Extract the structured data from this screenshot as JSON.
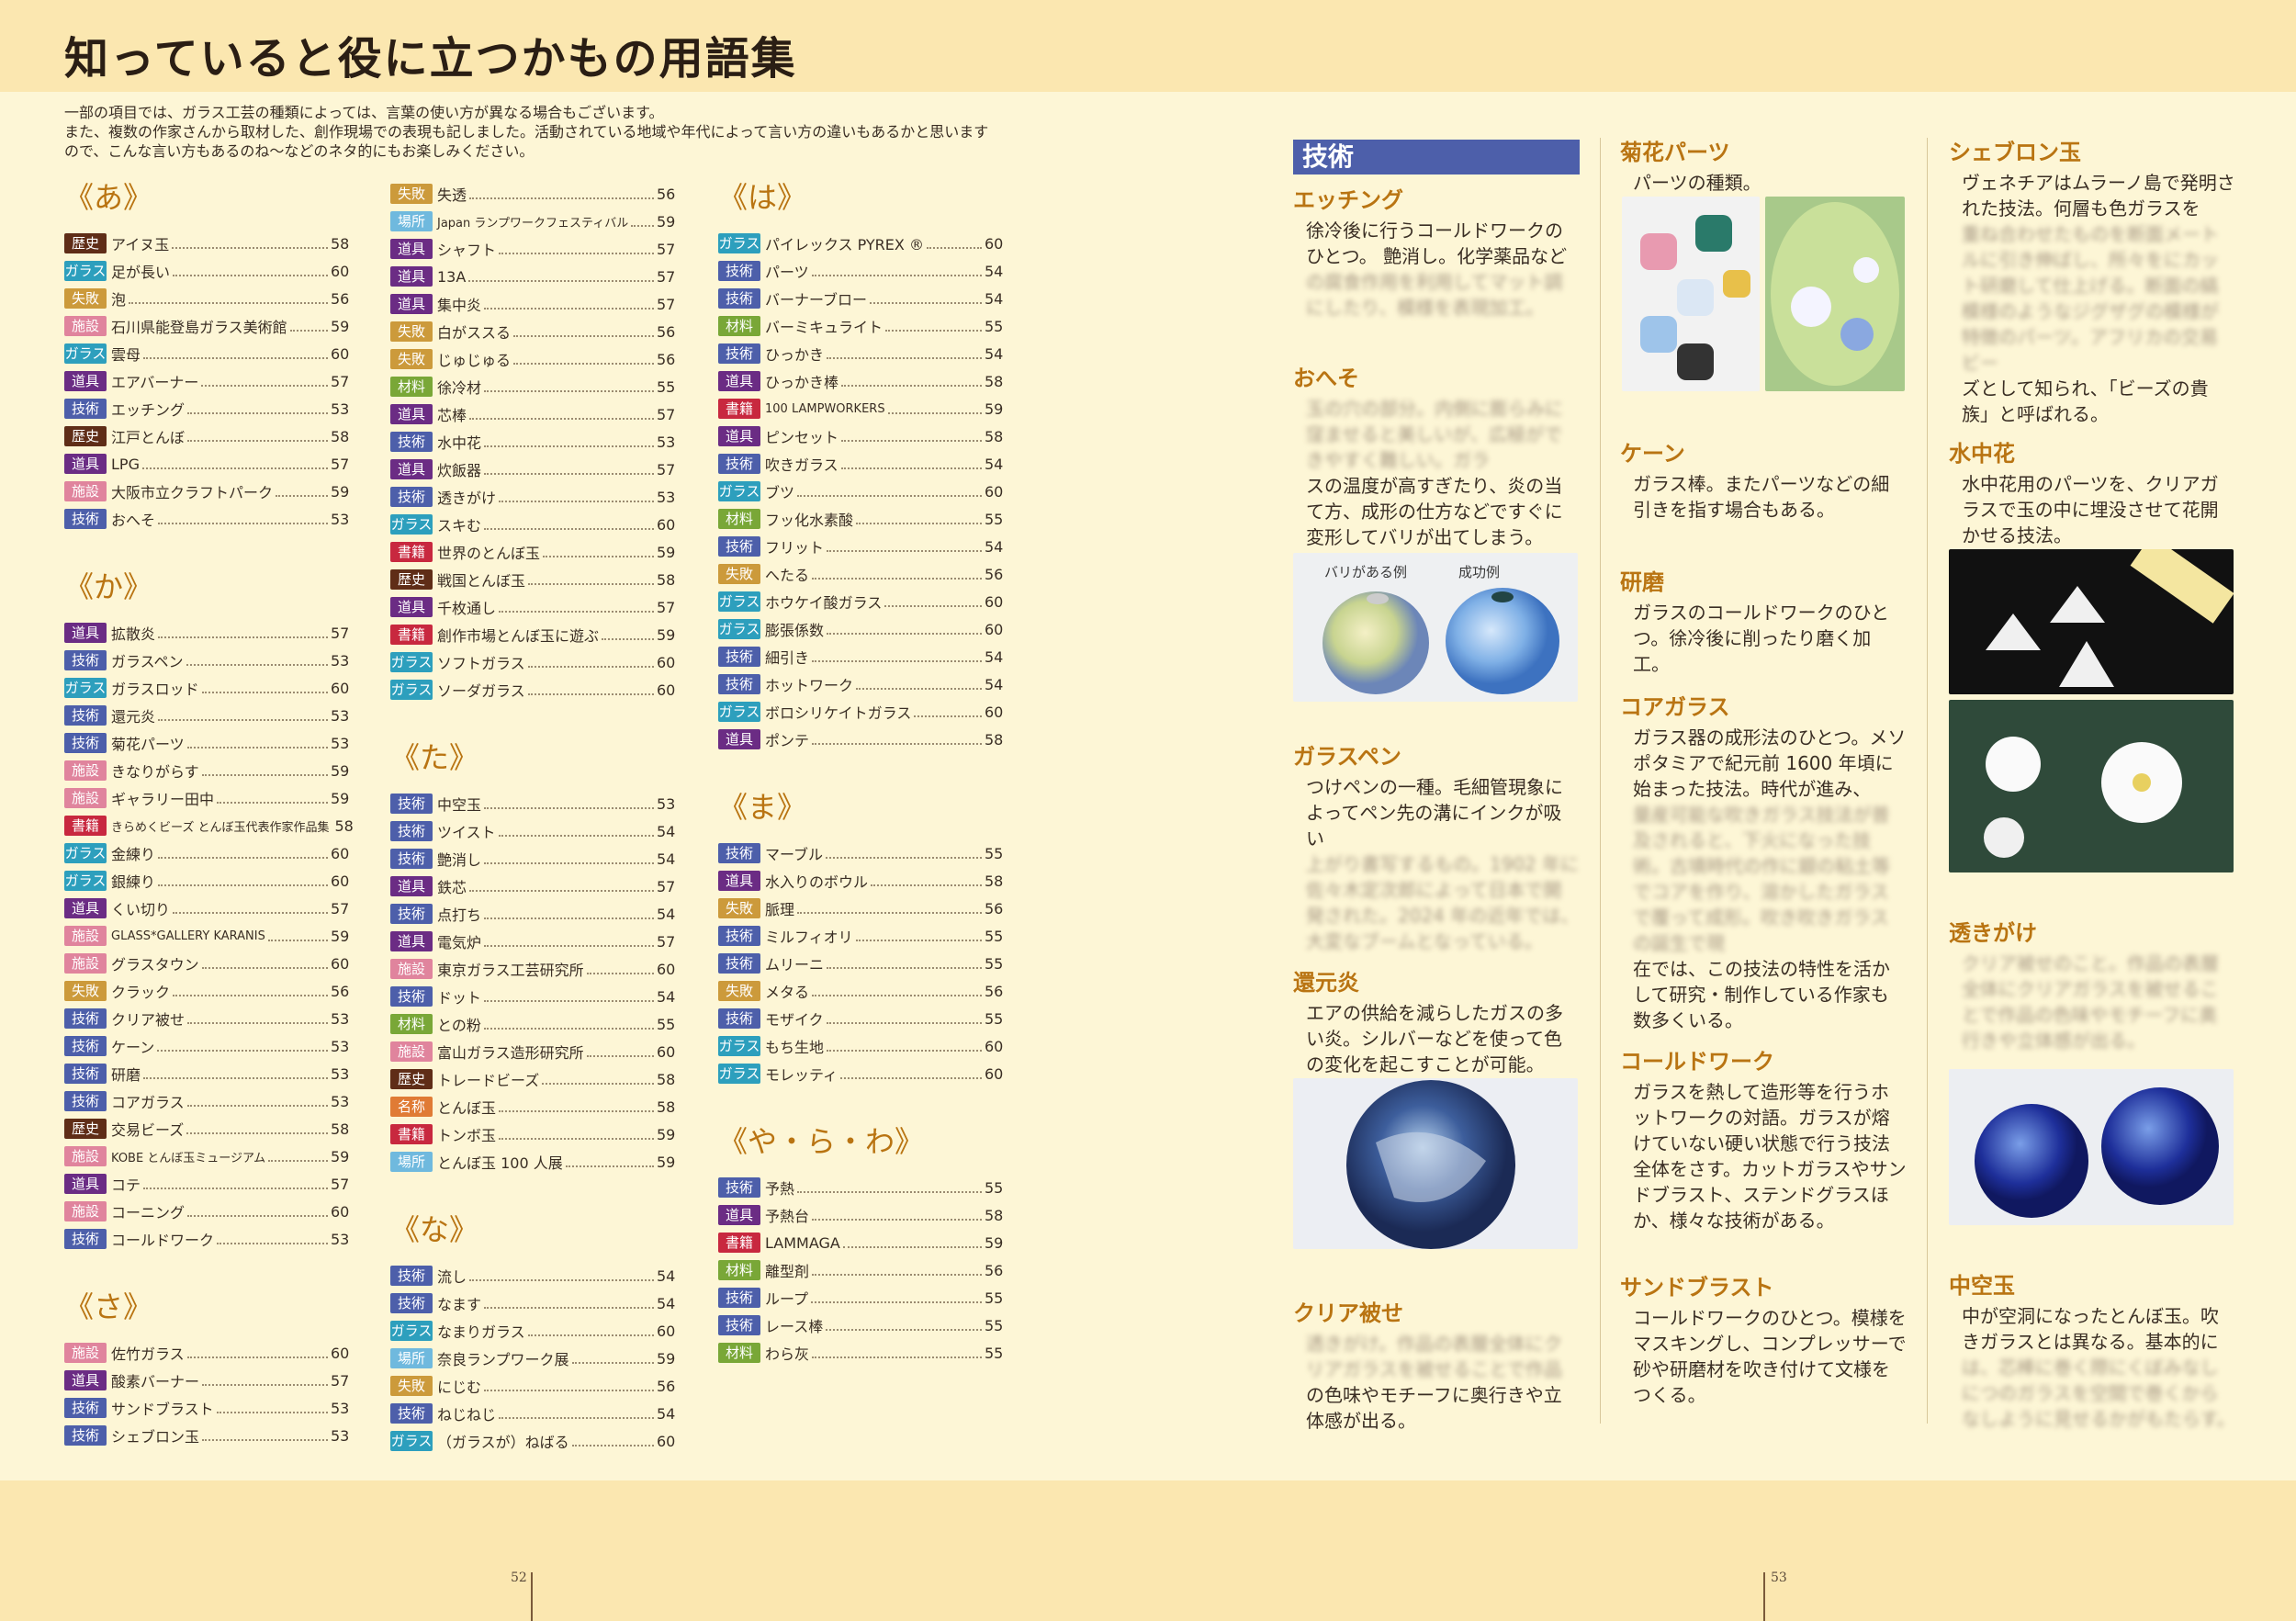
{
  "header": {
    "title": "知っていると役に立つかもの用語集"
  },
  "intro": [
    "一部の項目では、ガラス工芸の種類によっては、言葉の使い方が異なる場合もございます。",
    "また、複数の作家さんから取材した、創作現場での表現も記しました。活動されている地域や年代によって言い方の違いもあるかと思います",
    "ので、こんな言い方もあるのね〜などのネタ的にもお楽しみください。"
  ],
  "columns": [
    [
      {
        "h": "《あ》",
        "e": [
          [
            "歴史",
            "アイヌ玉",
            "58",
            "t-rekishi"
          ],
          [
            "ガラス",
            "足が長い",
            "60",
            "t-garasu"
          ],
          [
            "失敗",
            "泡",
            "56",
            "t-shippai"
          ],
          [
            "施設",
            "石川県能登島ガラス美術館",
            "59",
            "t-shisetsu"
          ],
          [
            "ガラス",
            "雲母",
            "60",
            "t-garasu"
          ],
          [
            "道具",
            "エアバーナー",
            "57",
            "t-dougu"
          ],
          [
            "技術",
            "エッチング",
            "53",
            "t-gijutsu"
          ],
          [
            "歴史",
            "江戸とんぼ",
            "58",
            "t-rekishi"
          ],
          [
            "道具",
            "LPG",
            "57",
            "t-dougu"
          ],
          [
            "施設",
            "大阪市立クラフトパーク",
            "59",
            "t-shisetsu"
          ],
          [
            "技術",
            "おへそ",
            "53",
            "t-gijutsu"
          ]
        ]
      },
      {
        "h": "《か》",
        "e": [
          [
            "道具",
            "拡散炎",
            "57",
            "t-dougu"
          ],
          [
            "技術",
            "ガラスペン",
            "53",
            "t-gijutsu"
          ],
          [
            "ガラス",
            "ガラスロッド",
            "60",
            "t-garasu"
          ],
          [
            "技術",
            "還元炎",
            "53",
            "t-gijutsu"
          ],
          [
            "技術",
            "菊花パーツ",
            "53",
            "t-gijutsu"
          ],
          [
            "施設",
            "きなりがらす",
            "59",
            "t-shisetsu"
          ],
          [
            "施設",
            "ギャラリー田中",
            "59",
            "t-shisetsu"
          ],
          [
            "書籍",
            "きらめくビーズ とんぼ玉代表作家作品集",
            "58",
            "t-shoseki"
          ],
          [
            "ガラス",
            "金練り",
            "60",
            "t-garasu"
          ],
          [
            "ガラス",
            "銀練り",
            "60",
            "t-garasu"
          ],
          [
            "道具",
            "くい切り",
            "57",
            "t-dougu"
          ],
          [
            "施設",
            "GLASS*GALLERY KARANIS",
            "59",
            "t-shisetsu"
          ],
          [
            "施設",
            "グラスタウン",
            "60",
            "t-shisetsu"
          ],
          [
            "失敗",
            "クラック",
            "56",
            "t-shippai"
          ],
          [
            "技術",
            "クリア被せ",
            "53",
            "t-gijutsu"
          ],
          [
            "技術",
            "ケーン",
            "53",
            "t-gijutsu"
          ],
          [
            "技術",
            "研磨",
            "53",
            "t-gijutsu"
          ],
          [
            "技術",
            "コアガラス",
            "53",
            "t-gijutsu"
          ],
          [
            "歴史",
            "交易ビーズ",
            "58",
            "t-rekishi"
          ],
          [
            "施設",
            "KOBE とんぼ玉ミュージアム",
            "59",
            "t-shisetsu"
          ],
          [
            "道具",
            "コテ",
            "57",
            "t-dougu"
          ],
          [
            "施設",
            "コーニング",
            "60",
            "t-shisetsu"
          ],
          [
            "技術",
            "コールドワーク",
            "53",
            "t-gijutsu"
          ]
        ]
      },
      {
        "h": "《さ》",
        "e": [
          [
            "施設",
            "佐竹ガラス",
            "60",
            "t-shisetsu"
          ],
          [
            "道具",
            "酸素バーナー",
            "57",
            "t-dougu"
          ],
          [
            "技術",
            "サンドブラスト",
            "53",
            "t-gijutsu"
          ],
          [
            "技術",
            "シェブロン玉",
            "53",
            "t-gijutsu"
          ]
        ]
      }
    ],
    [
      {
        "h": "",
        "e": [
          [
            "失敗",
            "失透",
            "56",
            "t-shippai"
          ],
          [
            "場所",
            "Japan ランプワークフェスティバル",
            "59",
            "t-basho"
          ],
          [
            "道具",
            "シャフト",
            "57",
            "t-dougu"
          ],
          [
            "道具",
            "13A",
            "57",
            "t-dougu"
          ],
          [
            "道具",
            "集中炎",
            "57",
            "t-dougu"
          ],
          [
            "失敗",
            "白がススる",
            "56",
            "t-shippai"
          ],
          [
            "失敗",
            "じゅじゅる",
            "56",
            "t-shippai"
          ],
          [
            "材料",
            "徐冷材",
            "55",
            "t-zairyou"
          ],
          [
            "道具",
            "芯棒",
            "57",
            "t-dougu"
          ],
          [
            "技術",
            "水中花",
            "53",
            "t-gijutsu"
          ],
          [
            "道具",
            "炊飯器",
            "57",
            "t-dougu"
          ],
          [
            "技術",
            "透きがけ",
            "53",
            "t-gijutsu"
          ],
          [
            "ガラス",
            "スキむ",
            "60",
            "t-garasu"
          ],
          [
            "書籍",
            "世界のとんぼ玉",
            "59",
            "t-shoseki"
          ],
          [
            "歴史",
            "戦国とんぼ玉",
            "58",
            "t-rekishi"
          ],
          [
            "道具",
            "千枚通し",
            "57",
            "t-dougu"
          ],
          [
            "書籍",
            "創作市場とんぼ玉に遊ぶ",
            "59",
            "t-shoseki"
          ],
          [
            "ガラス",
            "ソフトガラス",
            "60",
            "t-garasu"
          ],
          [
            "ガラス",
            "ソーダガラス",
            "60",
            "t-garasu"
          ]
        ]
      },
      {
        "h": "《た》",
        "e": [
          [
            "技術",
            "中空玉",
            "53",
            "t-gijutsu"
          ],
          [
            "技術",
            "ツイスト",
            "54",
            "t-gijutsu"
          ],
          [
            "技術",
            "艶消し",
            "54",
            "t-gijutsu"
          ],
          [
            "道具",
            "鉄芯",
            "57",
            "t-dougu"
          ],
          [
            "技術",
            "点打ち",
            "54",
            "t-gijutsu"
          ],
          [
            "道具",
            "電気炉",
            "57",
            "t-dougu"
          ],
          [
            "施設",
            "東京ガラス工芸研究所",
            "60",
            "t-shisetsu"
          ],
          [
            "技術",
            "ドット",
            "54",
            "t-gijutsu"
          ],
          [
            "材料",
            "との粉",
            "55",
            "t-zairyou"
          ],
          [
            "施設",
            "富山ガラス造形研究所",
            "60",
            "t-shisetsu"
          ],
          [
            "歴史",
            "トレードビーズ",
            "58",
            "t-rekishi"
          ],
          [
            "名称",
            "とんぼ玉",
            "58",
            "t-meishou"
          ],
          [
            "書籍",
            "トンボ玉",
            "59",
            "t-shoseki"
          ],
          [
            "場所",
            "とんぼ玉 100 人展",
            "59",
            "t-basho"
          ]
        ]
      },
      {
        "h": "《な》",
        "e": [
          [
            "技術",
            "流し",
            "54",
            "t-gijutsu"
          ],
          [
            "技術",
            "なます",
            "54",
            "t-gijutsu"
          ],
          [
            "ガラス",
            "なまりガラス",
            "60",
            "t-garasu"
          ],
          [
            "場所",
            "奈良ランプワーク展",
            "59",
            "t-basho"
          ],
          [
            "失敗",
            "にじむ",
            "56",
            "t-shippai"
          ],
          [
            "技術",
            "ねじねじ",
            "54",
            "t-gijutsu"
          ],
          [
            "ガラス",
            "（ガラスが）ねばる",
            "60",
            "t-garasu"
          ]
        ]
      }
    ],
    [
      {
        "h": "《は》",
        "e": [
          [
            "ガラス",
            "パイレックス PYREX ®",
            "60",
            "t-garasu"
          ],
          [
            "技術",
            "パーツ",
            "54",
            "t-gijutsu"
          ],
          [
            "技術",
            "バーナーブロー",
            "54",
            "t-gijutsu"
          ],
          [
            "材料",
            "バーミキュライト",
            "55",
            "t-zairyou"
          ],
          [
            "技術",
            "ひっかき",
            "54",
            "t-gijutsu"
          ],
          [
            "道具",
            "ひっかき棒",
            "58",
            "t-dougu"
          ],
          [
            "書籍",
            "100 LAMPWORKERS",
            "59",
            "t-shoseki"
          ],
          [
            "道具",
            "ピンセット",
            "58",
            "t-dougu"
          ],
          [
            "技術",
            "吹きガラス",
            "54",
            "t-gijutsu"
          ],
          [
            "ガラス",
            "ブツ",
            "60",
            "t-garasu"
          ],
          [
            "材料",
            "フッ化水素酸",
            "55",
            "t-zairyou"
          ],
          [
            "技術",
            "フリット",
            "54",
            "t-gijutsu"
          ],
          [
            "失敗",
            "へたる",
            "56",
            "t-shippai"
          ],
          [
            "ガラス",
            "ホウケイ酸ガラス",
            "60",
            "t-garasu"
          ],
          [
            "ガラス",
            "膨張係数",
            "60",
            "t-garasu"
          ],
          [
            "技術",
            "細引き",
            "54",
            "t-gijutsu"
          ],
          [
            "技術",
            "ホットワーク",
            "54",
            "t-gijutsu"
          ],
          [
            "ガラス",
            "ボロシリケイトガラス",
            "60",
            "t-garasu"
          ],
          [
            "道具",
            "ポンテ",
            "58",
            "t-dougu"
          ]
        ]
      },
      {
        "h": "《ま》",
        "e": [
          [
            "技術",
            "マーブル",
            "55",
            "t-gijutsu"
          ],
          [
            "道具",
            "水入りのボウル",
            "58",
            "t-dougu"
          ],
          [
            "失敗",
            "脈理",
            "56",
            "t-shippai"
          ],
          [
            "技術",
            "ミルフィオリ",
            "55",
            "t-gijutsu"
          ],
          [
            "技術",
            "ムリーニ",
            "55",
            "t-gijutsu"
          ],
          [
            "失敗",
            "メタる",
            "56",
            "t-shippai"
          ],
          [
            "技術",
            "モザイク",
            "55",
            "t-gijutsu"
          ],
          [
            "ガラス",
            "もち生地",
            "60",
            "t-garasu"
          ],
          [
            "ガラス",
            "モレッティ",
            "60",
            "t-garasu"
          ]
        ]
      },
      {
        "h": "《や・ら・わ》",
        "e": [
          [
            "技術",
            "予熱",
            "55",
            "t-gijutsu"
          ],
          [
            "道具",
            "予熱台",
            "58",
            "t-dougu"
          ],
          [
            "書籍",
            "LAMMAGA",
            "59",
            "t-shoseki"
          ],
          [
            "材料",
            "離型剤",
            "56",
            "t-zairyou"
          ],
          [
            "技術",
            "ループ",
            "55",
            "t-gijutsu"
          ],
          [
            "技術",
            "レース棒",
            "55",
            "t-gijutsu"
          ],
          [
            "材料",
            "わら灰",
            "55",
            "t-zairyou"
          ]
        ]
      }
    ]
  ],
  "right": {
    "category": "技術",
    "etching": {
      "term": "エッチング",
      "desc": "徐冷後に行うコールドワークのひとつ。 艶消し。化学薬品など",
      "blur": "の腐食作用を利用してマット調にしたり、模様を表現加工。"
    },
    "oheso": {
      "term": "おへそ",
      "blur": "玉の穴の部分。内側に膨らみに窪ませると美しいが、広極ができやすく難しい。ガラ",
      "desc": "スの温度が高すぎたり、炎の当て方、成形の仕方などですぐに変形してバリが出てしまう。"
    },
    "bari_labels": [
      "バリがある例",
      "成功例"
    ],
    "glasspen": {
      "term": "ガラスペン",
      "desc": "つけペンの一種。毛細管現象によってペン先の溝にインクが吸い",
      "blur": "上がり書写するもの。1902 年に佐々木定次郎によって日本で開発された。2024 年の近年では、大変なブームとなっている。"
    },
    "kangen": {
      "term": "還元炎",
      "desc": "エアの供給を減らしたガスの多い炎。シルバーなどを使って色の変化を起こすことが可能。"
    },
    "clear": {
      "term": "クリア被せ",
      "blur": "透きがけ。作品の表層全体にクリアガラスを被せることで作品",
      "desc": "の色味やモチーフに奥行きや立体感が出る。"
    },
    "kikka": {
      "term": "菊花パーツ",
      "desc": "パーツの種類。"
    },
    "cane": {
      "term": "ケーン",
      "desc": "ガラス棒。またパーツなどの細引きを指す場合もある。"
    },
    "kenma": {
      "term": "研磨",
      "desc": "ガラスのコールドワークのひとつ。徐冷後に削ったり磨く加工。"
    },
    "core": {
      "term": "コアガラス",
      "desc": "ガラス器の成形法のひとつ。メソポタミアで紀元前 1600 年頃に始まった技法。時代が進み、",
      "blur": "量産可能な吹きガラス技法が普及されると、下火になった技術。古墳時代の作に銀の粘土等でコアを作り、溶かしたガラスで覆って成形。吹き吹きガラスの誕生で現",
      "desc2": "在では、この技法の特性を活かして研究・制作している作家も数多くいる。"
    },
    "coldwork": {
      "term": "コールドワーク",
      "desc": "ガラスを熱して造形等を行うホットワークの対語。ガラスが熔けていない硬い状態で行う技法全体をさす。カットガラスやサンドブラスト、ステンドグラスほか、様々な技術がある。"
    },
    "sandblast": {
      "term": "サンドブラスト",
      "desc": "コールドワークのひとつ。模様をマスキングし、コンプレッサーで砂や研磨材を吹き付けて文様をつくる。"
    },
    "chevron": {
      "term": "シェブロン玉",
      "desc": "ヴェネチアはムラーノ島で発明された技法。何層も色ガラスを",
      "blur": "重ね合わせたものを断面メートルに引き伸ばし、所々をにカット研磨して仕上げる。断面の縞模様のようなジグザグの模様が特徴のパーツ。アフリカの交易ビー",
      "desc2": "ズとして知られ、「ビーズの貴族」と呼ばれる。"
    },
    "suichuka": {
      "term": "水中花",
      "desc": "水中花用のパーツを、クリアガラスで玉の中に埋没させて花開かせる技法。"
    },
    "sukigake": {
      "term": "透きがけ",
      "blur": "クリア被せのこと。作品の表層全体にクリアガラスを被せることで作品の色味やモチーフに奥行きや立体感が出る。"
    },
    "chukudama": {
      "term": "中空玉",
      "desc": "中が空洞になったとんぼ玉。吹きガラスとは異なる。基本的に",
      "blur": "は、芯棒に巻く際にくぼみなしにつのガラスを空間で巻くからなしように見せるかがもたらす。"
    }
  },
  "footer": {
    "page_left": "52",
    "page_right": "53"
  }
}
